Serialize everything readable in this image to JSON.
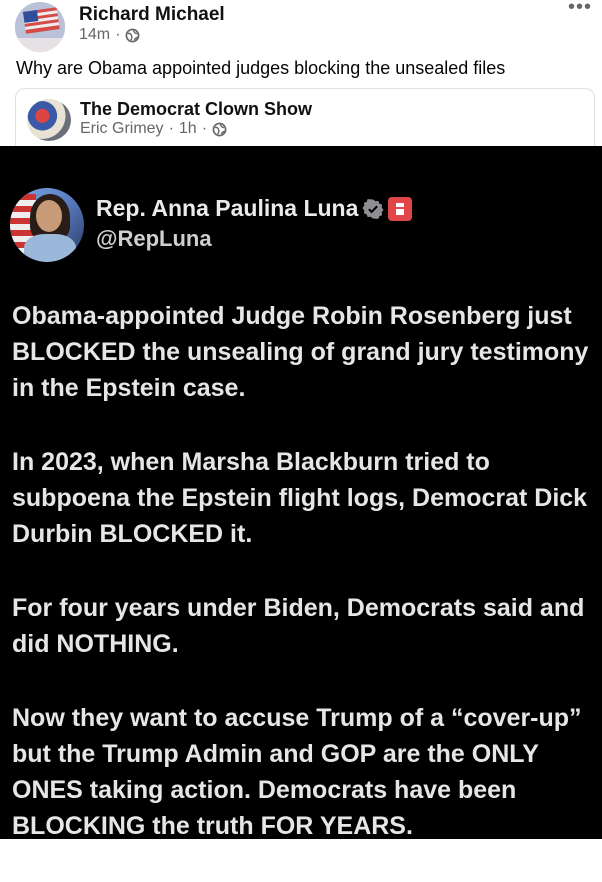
{
  "post": {
    "author": "Richard Michael",
    "time": "14m",
    "separator": "·",
    "text": "Why are Obama appointed judges blocking the unsealed files",
    "more_icon": "•••"
  },
  "shared": {
    "group_name": "The Democrat Clown Show",
    "poster": "Eric Grimey",
    "time": "1h",
    "separator": "·"
  },
  "tweet": {
    "name": "Rep. Anna Paulina Luna",
    "handle": "@RepLuna",
    "paragraphs": [
      "Obama-appointed Judge Robin Rosenberg just BLOCKED the unsealing of grand jury testimony in the Epstein case.",
      "In 2023, when Marsha Blackburn tried to subpoena the Epstein flight logs, Democrat Dick Durbin BLOCKED it.",
      "For four years under Biden, Democrats said and did NOTHING.",
      "Now they want to accuse Trump of a “cover-up” but the Trump Admin and GOP are the ONLY ONES taking action. Democrats have been BLOCKING the truth FOR YEARS."
    ]
  },
  "icons": {
    "globe": "globe-icon",
    "verified": "verified-badge-icon",
    "republican": "republican-badge-icon"
  },
  "colors": {
    "meta_gray": "#65676b",
    "tweet_bg": "#000000",
    "rep_red": "#e0464a"
  }
}
